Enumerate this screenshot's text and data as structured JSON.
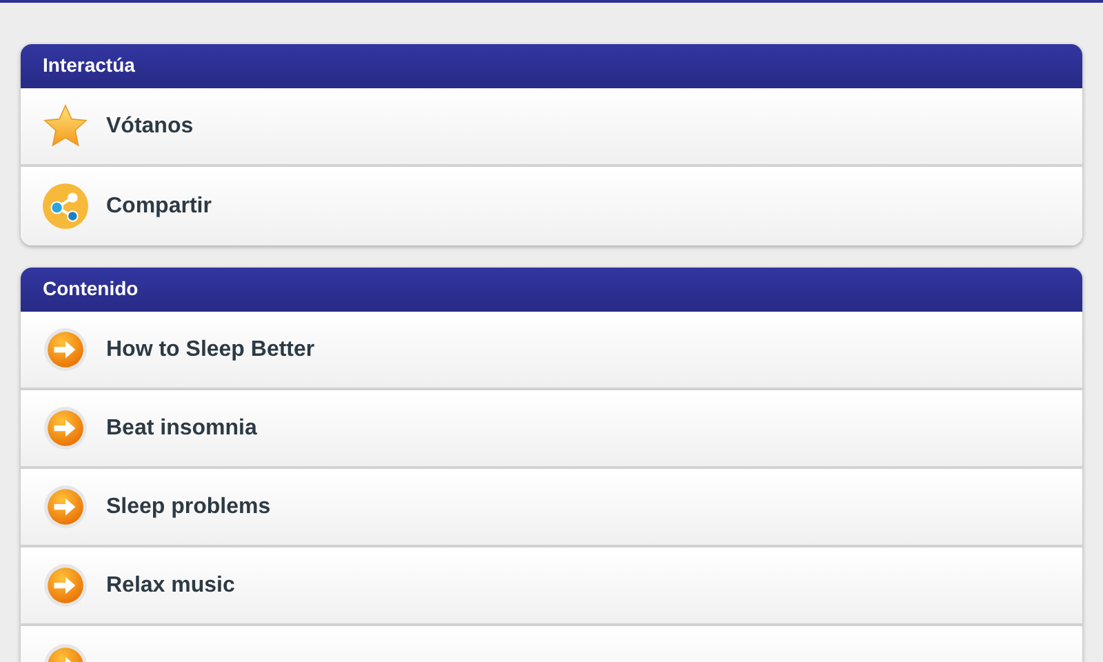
{
  "sections": [
    {
      "title": "Interactúa",
      "items": [
        {
          "label": "Vótanos",
          "kind": "star"
        },
        {
          "label": "Compartir",
          "kind": "share"
        }
      ]
    },
    {
      "title": "Contenido",
      "items": [
        {
          "label": "How to Sleep Better",
          "kind": "arrow"
        },
        {
          "label": "Beat insomnia",
          "kind": "arrow"
        },
        {
          "label": "Sleep problems",
          "kind": "arrow"
        },
        {
          "label": "Relax music",
          "kind": "arrow"
        },
        {
          "kind": "arrow"
        }
      ]
    }
  ]
}
